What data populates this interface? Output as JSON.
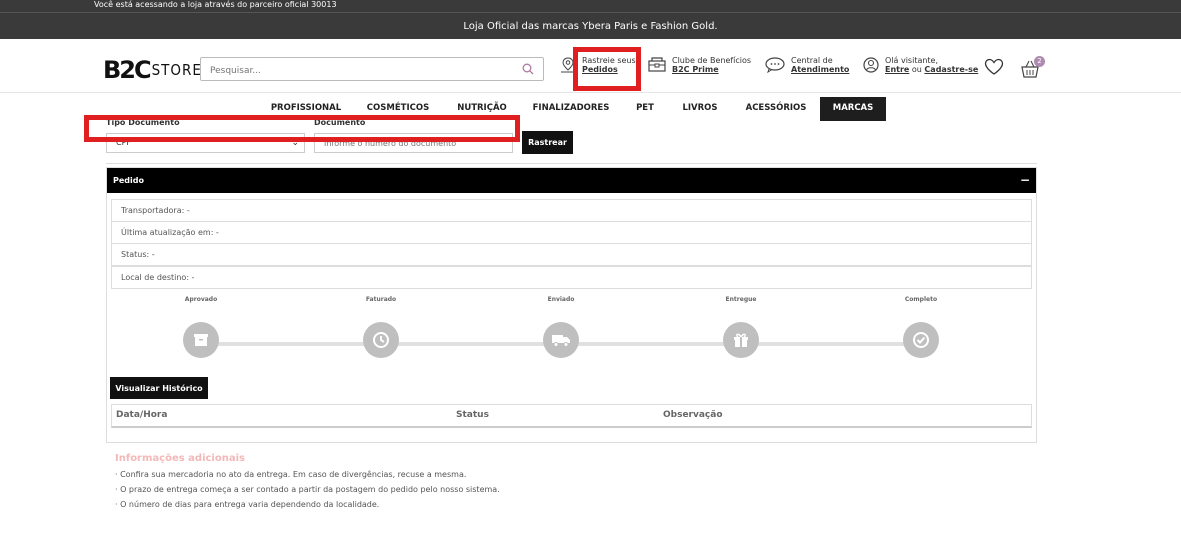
{
  "topbar": {
    "text": "Você está acessando a loja através do parceiro oficial 30013"
  },
  "promobar": {
    "text": "Loja Oficial das marcas Ybera Paris e Fashion Gold."
  },
  "header": {
    "logo_main": "B2C",
    "logo_sub": "STORE",
    "search_placeholder": "Pesquisar...",
    "track": {
      "line1": "Rastreie seus",
      "line2": "Pedidos"
    },
    "club": {
      "line1": "Clube de Benefícios",
      "line2": "B2C Prime"
    },
    "support": {
      "line1": "Central de",
      "line2": "Atendimento"
    },
    "account": {
      "line1": "Olá visitante,",
      "login": "Entre",
      "or": "ou",
      "signup": "Cadastre-se"
    },
    "cart_count": "2"
  },
  "nav": {
    "items": [
      "PROFISSIONAL",
      "COSMÉTICOS",
      "NUTRIÇÃO",
      "FINALIZADORES",
      "PET",
      "LIVROS",
      "ACESSÓRIOS",
      "MARCAS"
    ]
  },
  "tracking_form": {
    "doc_type_label": "Tipo Documento",
    "doc_type_value": "CPF",
    "doc_label": "Documento",
    "doc_placeholder": "Informe o número do documento",
    "submit_label": "Rastrear"
  },
  "order_panel": {
    "title": "Pedido",
    "collapse_symbol": "−",
    "rows": [
      "Transportadora: -",
      "Última atualização em: -",
      "Status: -",
      "Local de destino: -"
    ],
    "steps": [
      "Aprovado",
      "Faturado",
      "Enviado",
      "Entregue",
      "Completo"
    ],
    "step_icons": [
      "box-icon",
      "clock-icon",
      "truck-icon",
      "gift-icon",
      "check-icon"
    ],
    "history_button": "Visualizar Histórico",
    "history_columns": [
      "Data/Hora",
      "Status",
      "Observação"
    ]
  },
  "additional_info": {
    "title": "Informações adicionais",
    "items": [
      "· Confira sua mercadoria no ato da entrega. Em caso de divergências, recuse a mesma.",
      "· O prazo de entrega começa a ser contado a partir da postagem do pedido pelo nosso sistema.",
      "· O número de dias para entrega varia dependendo da localidade."
    ]
  },
  "colors": {
    "highlight": "#e02020",
    "dark": "#1e1e1e",
    "step_gray": "#bfbfbf",
    "cart_badge": "#b08bb0"
  }
}
